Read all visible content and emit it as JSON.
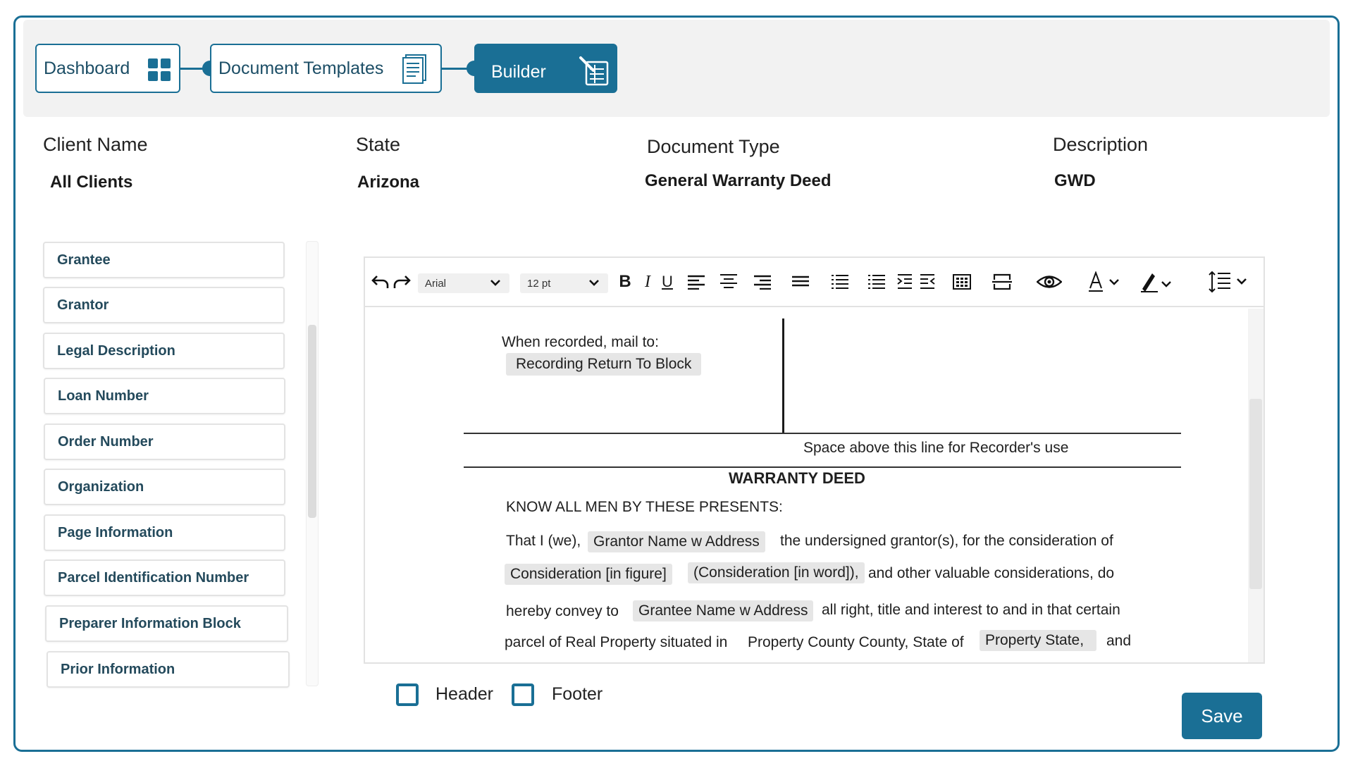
{
  "breadcrumb": {
    "items": [
      {
        "label": "Dashboard",
        "icon": "grid-icon"
      },
      {
        "label": "Document Templates",
        "icon": "document-list-icon"
      },
      {
        "label": "Builder",
        "icon": "builder-icon",
        "active": true
      }
    ]
  },
  "meta": {
    "client_name": {
      "label": "Client Name",
      "value": "All Clients"
    },
    "state": {
      "label": "State",
      "value": "Arizona"
    },
    "document_type": {
      "label": "Document Type",
      "value": "General Warranty Deed"
    },
    "description": {
      "label": "Description",
      "value": "GWD"
    }
  },
  "fields": [
    "Grantee",
    "Grantor",
    "Legal Description",
    "Loan Number",
    "Order Number",
    "Organization",
    "Page Information",
    "Parcel Identification Number",
    "Preparer Information Block",
    "Prior Information"
  ],
  "toolbar": {
    "font_family": "Arial",
    "font_size": "12 pt",
    "bold": "B",
    "italic": "I",
    "underline": "U"
  },
  "document": {
    "mail_to": "When recorded, mail to:",
    "recording_block": "Recording Return To Block",
    "recorder_note": "Space above this line for Recorder's use",
    "title": "WARRANTY DEED",
    "know_all": "KNOW ALL MEN BY THESE PRESENTS:",
    "line1_a": "That I (we),",
    "chip_grantor": "Grantor Name w Address",
    "line1_b": "the undersigned grantor(s), for the consideration of",
    "chip_consideration_figure": "Consideration [in figure]",
    "chip_consideration_word": "(Consideration [in word]),",
    "line2_b": "and other valuable considerations, do",
    "line3_a": "hereby convey to",
    "chip_grantee": "Grantee Name w Address",
    "line3_b": "all right, title and interest to and in that certain",
    "line4_a": "parcel of Real Property situated in",
    "line4_b": "Property County County, State of",
    "chip_property_state": "Property State,",
    "line4_c": "and"
  },
  "options": {
    "header_label": "Header",
    "footer_label": "Footer"
  },
  "actions": {
    "save_label": "Save"
  },
  "colors": {
    "accent": "#1a6f95",
    "chip_bg": "#e6e6e6"
  }
}
